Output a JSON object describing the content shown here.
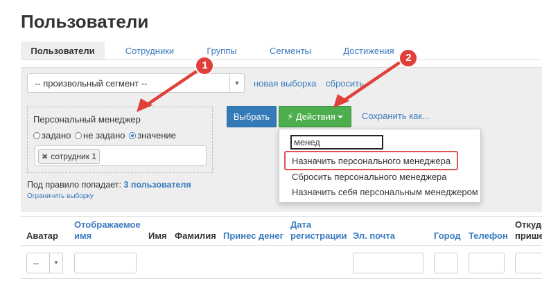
{
  "page": {
    "title": "Пользователи"
  },
  "tabs": [
    {
      "label": "Пользователи"
    },
    {
      "label": "Сотрудники"
    },
    {
      "label": "Группы"
    },
    {
      "label": "Сегменты"
    },
    {
      "label": "Достижения"
    }
  ],
  "segment": {
    "value": "-- произвольный сегмент --",
    "new_link": "новая выборка",
    "reset_link": "сбросить"
  },
  "filter": {
    "label": "Персональный менеджер",
    "radios": [
      {
        "label": "задано",
        "checked": false
      },
      {
        "label": "не задано",
        "checked": false
      },
      {
        "label": "значение",
        "checked": true
      }
    ],
    "tag": "сотрудник 1"
  },
  "summary": {
    "prefix": "Под правило попадает:",
    "count": "3 пользователя",
    "limit_link": "Ограничить выборку"
  },
  "actions": {
    "select_label": "Выбрать",
    "actions_label": "Действия",
    "save_label": "Сохранить как..."
  },
  "dropdown": {
    "search_value": "менед",
    "items": [
      {
        "label": "Назначить персонального менеджера"
      },
      {
        "label": "Сбросить персонального менеджера"
      },
      {
        "label": "Назначить себя персональным менеджером"
      }
    ]
  },
  "annotations": [
    {
      "label": "1"
    },
    {
      "label": "2"
    }
  ],
  "table": {
    "headers": [
      {
        "label": "Аватар"
      },
      {
        "label": "Отображаемое имя"
      },
      {
        "label": "Имя"
      },
      {
        "label": "Фамилия"
      },
      {
        "label": "Принес денег"
      },
      {
        "label": "Дата регистрации"
      },
      {
        "label": "Эл. почта"
      },
      {
        "label": "Город"
      },
      {
        "label": "Телефон"
      },
      {
        "label": "Откуда пришел"
      }
    ],
    "avatar_select": "--"
  },
  "colors": {
    "accent": "#3a7bbf",
    "primary": "#337ab7",
    "success": "#4cae4c",
    "annotation": "#e0403a"
  }
}
